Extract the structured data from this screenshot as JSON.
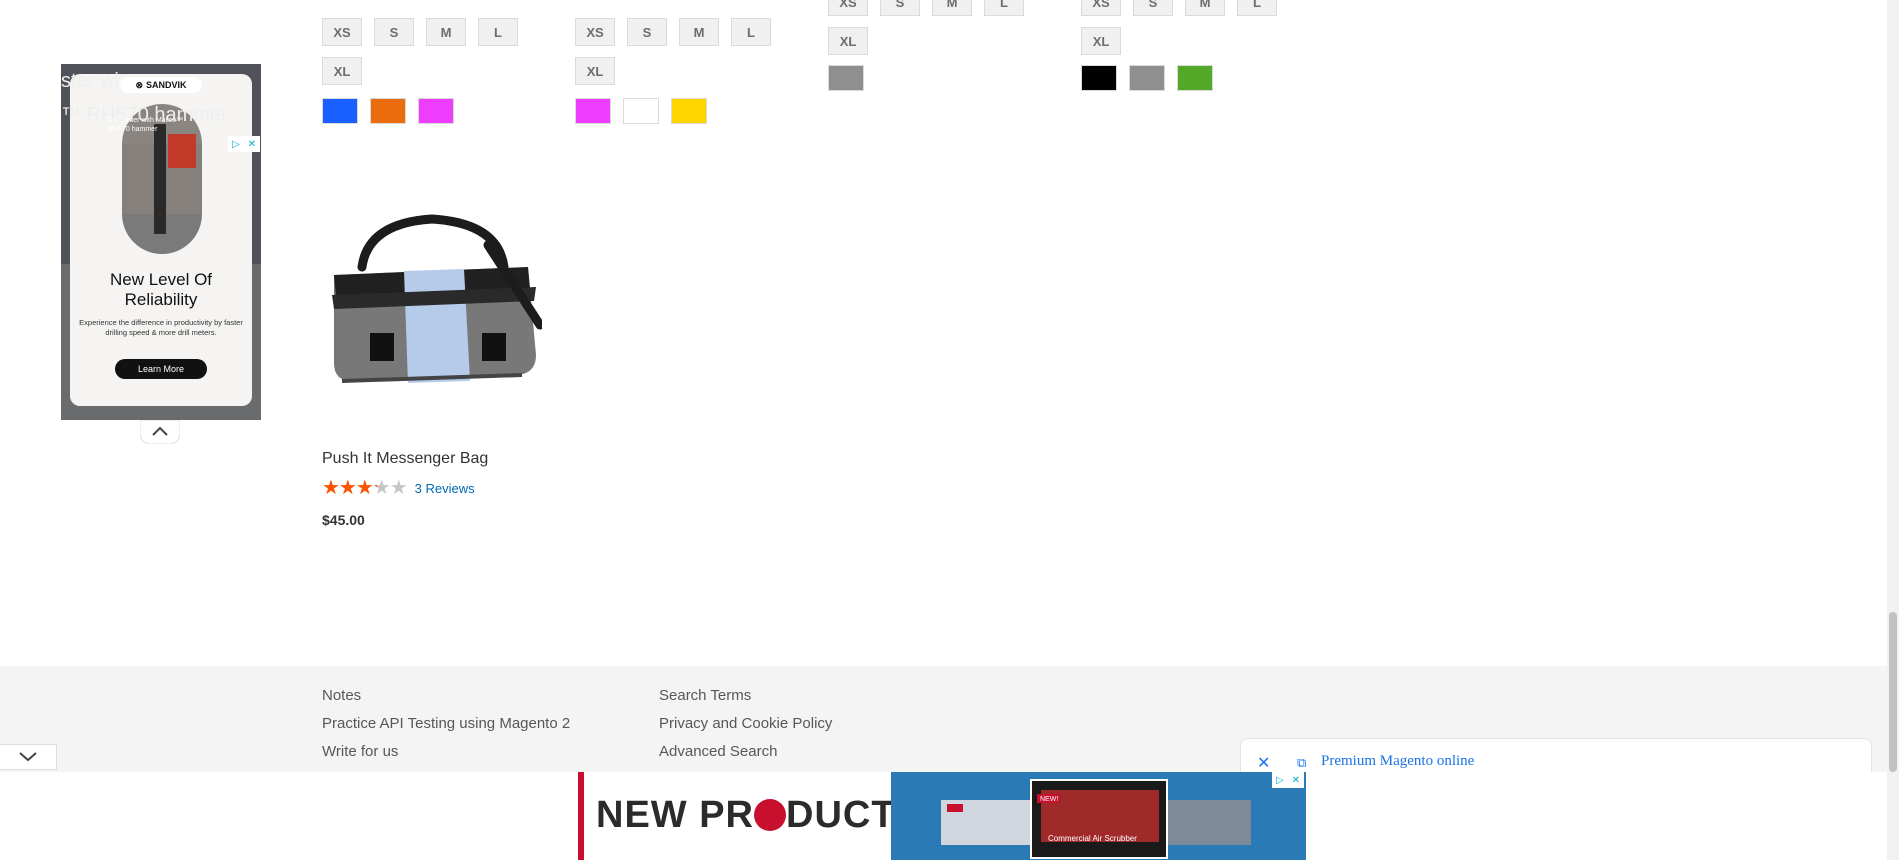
{
  "grid": {
    "columns": [
      {
        "sizes_row1": [
          "XS",
          "S",
          "M",
          "L"
        ],
        "sizes_row2": [
          "XL"
        ],
        "colors": [
          "#1a5fff",
          "#eb6c0c",
          "#ef3dff"
        ]
      },
      {
        "sizes_row1": [
          "XS",
          "S",
          "M",
          "L"
        ],
        "sizes_row2": [
          "XL"
        ],
        "colors": [
          "#ef3dff",
          "#ffffff",
          "#ffd500"
        ]
      },
      {
        "sizes_row1": [
          "XS",
          "S",
          "M",
          "L"
        ],
        "sizes_row2": [
          "XL"
        ],
        "colors": [
          "#8f8f8f"
        ]
      },
      {
        "sizes_row1": [
          "XS",
          "S",
          "M",
          "L"
        ],
        "sizes_row2": [
          "XL"
        ],
        "colors": [
          "#000000",
          "#8f8f8f",
          "#53a828"
        ]
      }
    ]
  },
  "product": {
    "name": "Push It Messenger Bag",
    "rating_percent": 65,
    "reviews": "3 Reviews",
    "price": "$45.00"
  },
  "left_ad": {
    "brand": "SANDVIK",
    "bg_text": "ster wi",
    "bg_text2": "™ RH570 hammer",
    "subtitle": "Drill faster with Mallco™ RH570 hammer",
    "headline": "New Level Of Reliability",
    "body": "Experience the difference in productivity by faster drilling speed & more drill meters.",
    "cta": "Learn More"
  },
  "footer": {
    "col1": [
      "Notes",
      "Practice API Testing using Magento 2",
      "Write for us"
    ],
    "col2": [
      "Search Terms",
      "Privacy and Cookie Policy",
      "Advanced Search"
    ]
  },
  "right_promo": {
    "text": "Premium Magento online"
  },
  "bottom_ad": {
    "title_left": "NEW PR",
    "title_right": "DUCTS",
    "badge": "NEW!",
    "caption": "Commercial Air Scrubber"
  },
  "colors": {
    "accent": "#006bb4",
    "star": "#ff5501",
    "footer_bg": "#f4f4f4"
  }
}
